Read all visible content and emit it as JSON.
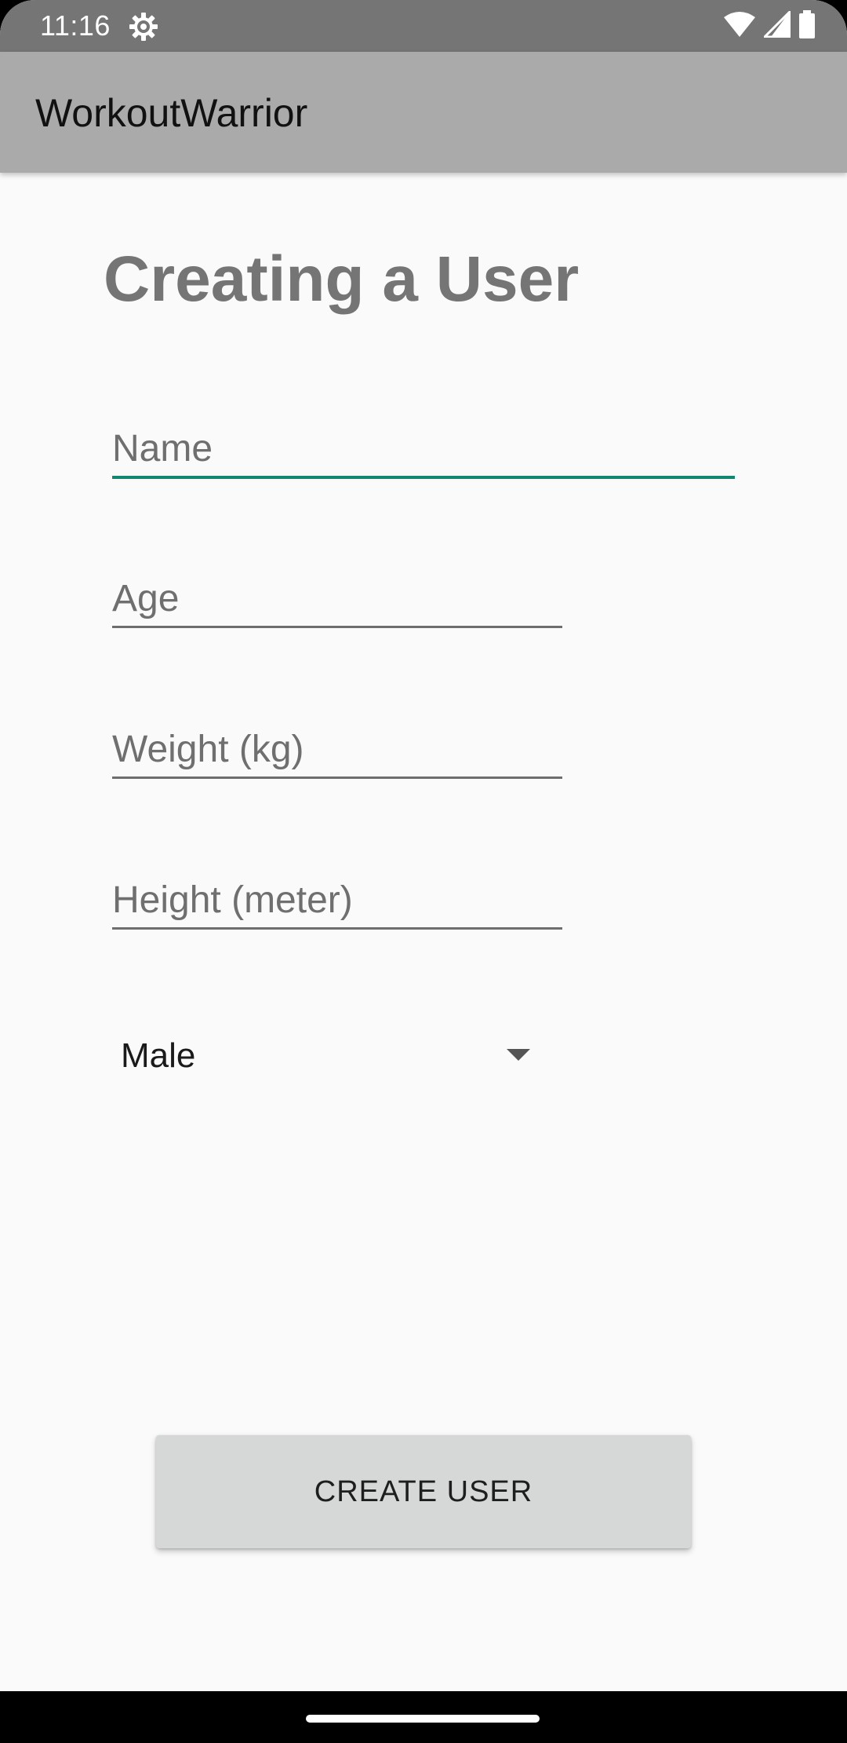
{
  "status_bar": {
    "time": "11:16",
    "icons": [
      "settings-gear-icon",
      "wifi-icon",
      "cell-signal-icon",
      "battery-icon"
    ]
  },
  "app_bar": {
    "title": "WorkoutWarrior"
  },
  "page": {
    "heading": "Creating a User"
  },
  "form": {
    "name": {
      "value": "",
      "placeholder": "Name"
    },
    "age": {
      "value": "",
      "placeholder": "Age"
    },
    "weight": {
      "value": "",
      "placeholder": "Weight (kg)"
    },
    "height": {
      "value": "",
      "placeholder": "Height (meter)"
    },
    "gender": {
      "selected": "Male"
    }
  },
  "actions": {
    "create_user_label": "CREATE USER"
  },
  "colors": {
    "status_bar": "#757575",
    "app_bar": "#aaaaaa",
    "background": "#fafafa",
    "accent_focus": "#138573",
    "heading_text": "#757575",
    "button": "#d6d7d7"
  }
}
